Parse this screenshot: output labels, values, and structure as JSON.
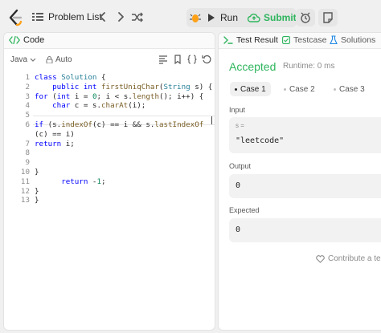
{
  "nav": {
    "problem_list_label": "Problem List",
    "run_label": "Run",
    "submit_label": "Submit",
    "accent_green": "#2db55d"
  },
  "editor": {
    "tab_label": "Code",
    "language": "Java",
    "autocomplete_label": "Auto",
    "lines": [
      {
        "n": "1",
        "tokens": [
          {
            "t": "class ",
            "c": "kw"
          },
          {
            "t": "Solution ",
            "c": "ty"
          },
          {
            "t": "{",
            "c": "pl"
          }
        ]
      },
      {
        "n": "2",
        "tokens": [
          {
            "t": "    public int ",
            "c": "kw"
          },
          {
            "t": "firstUniqChar",
            "c": "fn"
          },
          {
            "t": "(",
            "c": "pl"
          },
          {
            "t": "String",
            "c": "ty"
          },
          {
            "t": " s) {",
            "c": "pl"
          }
        ]
      },
      {
        "n": "3",
        "tokens": [
          {
            "t": "for ",
            "c": "kw"
          },
          {
            "t": "(",
            "c": "pl"
          },
          {
            "t": "int ",
            "c": "kw"
          },
          {
            "t": "i = ",
            "c": "pl"
          },
          {
            "t": "0",
            "c": "nm"
          },
          {
            "t": "; i < s.",
            "c": "pl"
          },
          {
            "t": "length",
            "c": "fn"
          },
          {
            "t": "(); i++) {",
            "c": "pl"
          }
        ]
      },
      {
        "n": "4",
        "tokens": [
          {
            "t": "    char ",
            "c": "kw"
          },
          {
            "t": "c = s.",
            "c": "pl"
          },
          {
            "t": "charAt",
            "c": "fn"
          },
          {
            "t": "(i);",
            "c": "pl"
          }
        ]
      },
      {
        "n": "5",
        "tokens": []
      },
      {
        "n": "6",
        "tokens": [
          {
            "t": "if ",
            "c": "kw"
          },
          {
            "t": "(s.",
            "c": "pl"
          },
          {
            "t": "indexOf",
            "c": "fn"
          },
          {
            "t": "(c) == i && s.",
            "c": "pl"
          },
          {
            "t": "lastIndexOf",
            "c": "fn"
          }
        ]
      },
      {
        "n": "",
        "tokens": [
          {
            "t": "(c) == i)",
            "c": "pl"
          }
        ]
      },
      {
        "n": "7",
        "tokens": [
          {
            "t": "return ",
            "c": "kw"
          },
          {
            "t": "i;",
            "c": "pl"
          }
        ]
      },
      {
        "n": "8",
        "tokens": []
      },
      {
        "n": "9",
        "tokens": []
      },
      {
        "n": "10",
        "tokens": [
          {
            "t": "}",
            "c": "pl"
          }
        ]
      },
      {
        "n": "11",
        "tokens": [
          {
            "t": "      return ",
            "c": "kw"
          },
          {
            "t": "-",
            "c": "pl"
          },
          {
            "t": "1",
            "c": "nm"
          },
          {
            "t": ";",
            "c": "pl"
          }
        ]
      },
      {
        "n": "12",
        "tokens": [
          {
            "t": "}",
            "c": "pl"
          }
        ]
      },
      {
        "n": "13",
        "tokens": [
          {
            "t": "}",
            "c": "pl"
          }
        ]
      }
    ]
  },
  "result": {
    "tabs": [
      "Test Result",
      "Testcase",
      "Solutions"
    ],
    "status": "Accepted",
    "runtime": "Runtime: 0 ms",
    "cases": [
      "Case 1",
      "Case 2",
      "Case 3"
    ],
    "input_label": "Input",
    "input_var": "s =",
    "input_value": "\"leetcode\"",
    "output_label": "Output",
    "output_value": "0",
    "expected_label": "Expected",
    "expected_value": "0",
    "contribute_label": "Contribute a test"
  }
}
